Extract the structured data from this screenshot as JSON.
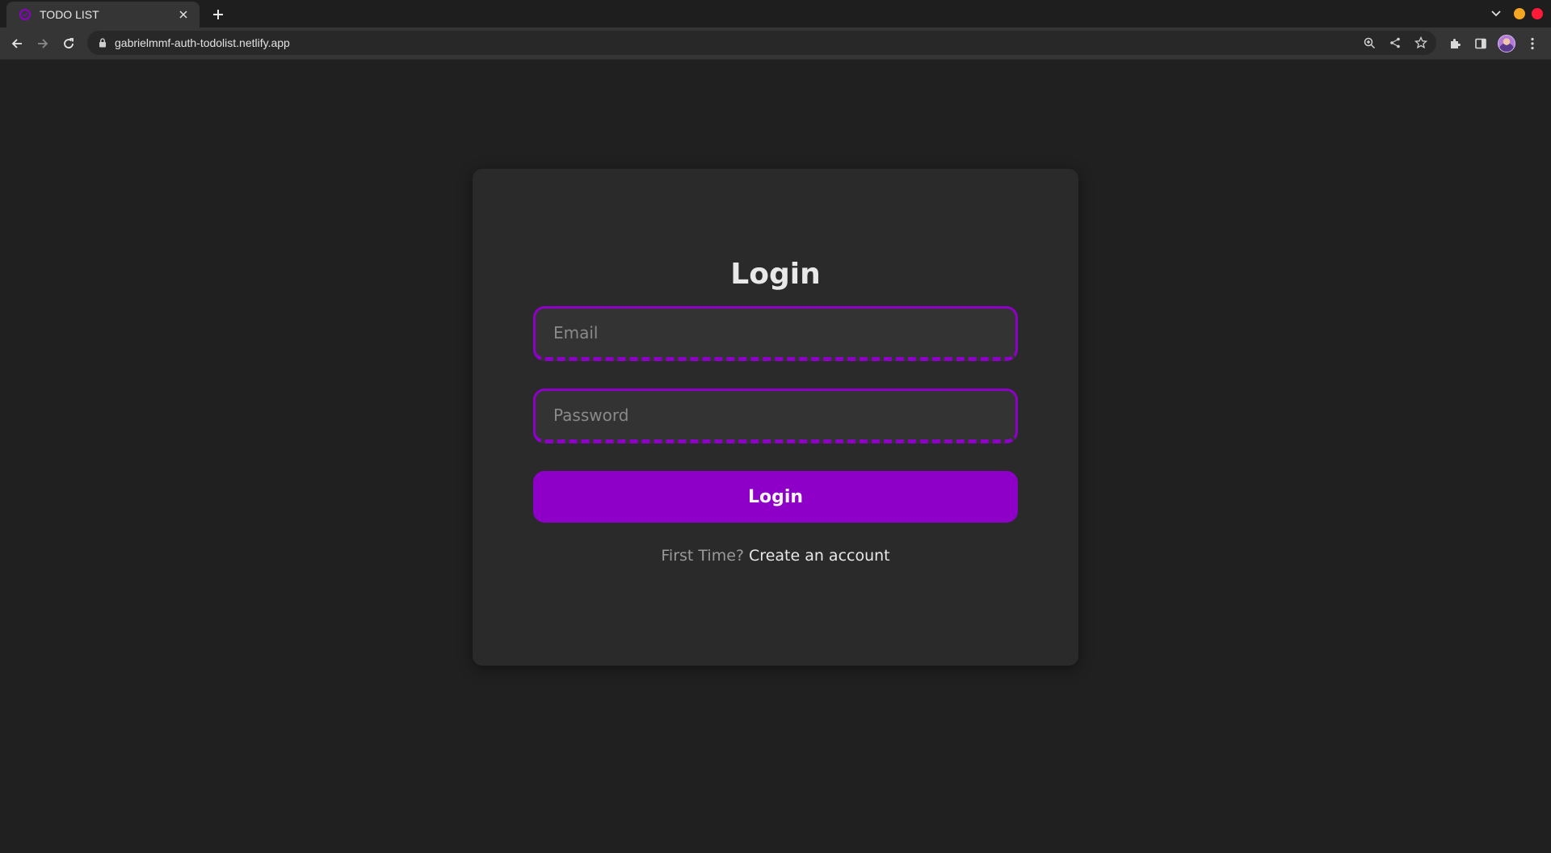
{
  "browser": {
    "tab": {
      "title": "TODO LIST",
      "favicon": "check-circle-icon"
    },
    "address_bar": {
      "url": "gabrielmmf-auth-todolist.netlify.app"
    },
    "colors": {
      "accent": "#8e00c8",
      "minimize": "#f5a623",
      "close": "#ff1a3a"
    }
  },
  "login": {
    "title": "Login",
    "email_placeholder": "Email",
    "password_placeholder": "Password",
    "submit_label": "Login",
    "signup_prompt": "First Time?",
    "signup_link": "Create an account"
  },
  "colors": {
    "background": "#202020",
    "card": "#2a2a2a",
    "accent": "#8e00c8"
  }
}
